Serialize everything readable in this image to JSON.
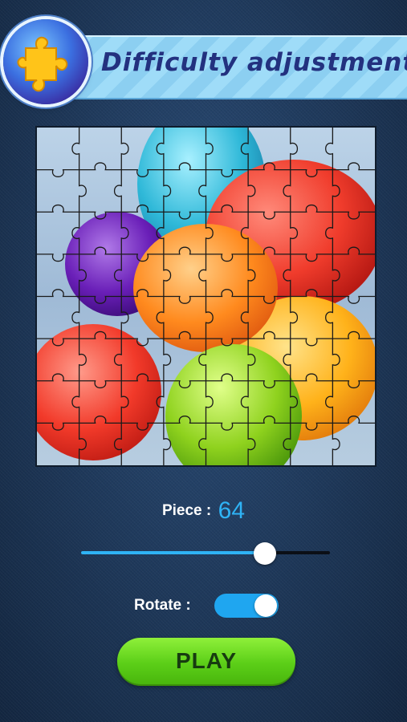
{
  "header": {
    "title": "Difficulty adjustment",
    "logo_icon": "puzzle-piece-icon",
    "accent_color": "#23317f"
  },
  "puzzle": {
    "image_subject": "balloons",
    "grid_size": 8,
    "balloons": [
      {
        "color": "#2eb8d8",
        "name": "cyan"
      },
      {
        "color": "#6a1fb8",
        "name": "purple"
      },
      {
        "color": "#f03c2c",
        "name": "red"
      },
      {
        "color": "#ff8a1e",
        "name": "orange"
      },
      {
        "color": "#ffb21a",
        "name": "yellow-orange"
      },
      {
        "color": "#8fd21e",
        "name": "green"
      }
    ]
  },
  "settings": {
    "piece_label": "Piece :",
    "piece_value": "64",
    "slider_fraction": 0.74,
    "rotate_label": "Rotate :",
    "rotate_on": true,
    "accent_color": "#2fb3f5"
  },
  "play": {
    "label": "PLAY",
    "color": "#5ccf18"
  }
}
